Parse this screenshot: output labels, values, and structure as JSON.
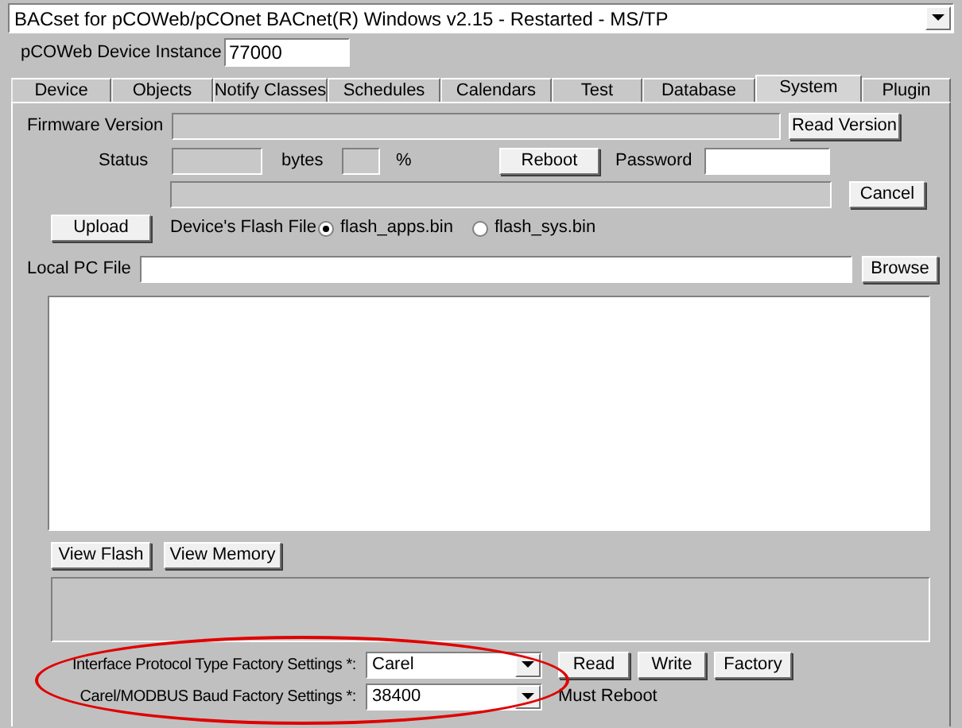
{
  "window": {
    "title": "BACset for pCOWeb/pCOnet BACnet(R)  Windows v2.15  - Restarted - MS/TP"
  },
  "device_instance": {
    "label": "pCOWeb Device Instance",
    "value": "77000"
  },
  "tabs": [
    {
      "label": "Device",
      "selected": false
    },
    {
      "label": "Objects",
      "selected": false
    },
    {
      "label": "Notify Classes",
      "selected": false
    },
    {
      "label": "Schedules",
      "selected": false
    },
    {
      "label": "Calendars",
      "selected": false
    },
    {
      "label": "Test",
      "selected": false
    },
    {
      "label": "Database",
      "selected": false
    },
    {
      "label": "System",
      "selected": true
    },
    {
      "label": "Plugin",
      "selected": false
    }
  ],
  "firmware": {
    "label": "Firmware Version",
    "button": "Read Version"
  },
  "status": {
    "label": "Status",
    "bytes_label": "bytes",
    "percent_label": "%",
    "reboot_button": "Reboot",
    "password_label": "Password"
  },
  "cancel_button": "Cancel",
  "upload": {
    "button": "Upload",
    "flash_label": "Device's Flash File",
    "options": [
      {
        "label": "flash_apps.bin",
        "selected": true
      },
      {
        "label": "flash_sys.bin",
        "selected": false
      }
    ]
  },
  "local_file": {
    "label": "Local PC File",
    "button": "Browse"
  },
  "view_buttons": [
    "View Flash",
    "View Memory"
  ],
  "factory_settings": [
    {
      "label": "Interface Protocol Type Factory Settings *:",
      "value": "Carel"
    },
    {
      "label": "Carel/MODBUS Baud Factory Settings *:",
      "value": "38400"
    }
  ],
  "factory_buttons": [
    "Read",
    "Write",
    "Factory"
  ],
  "note": "Must Reboot"
}
